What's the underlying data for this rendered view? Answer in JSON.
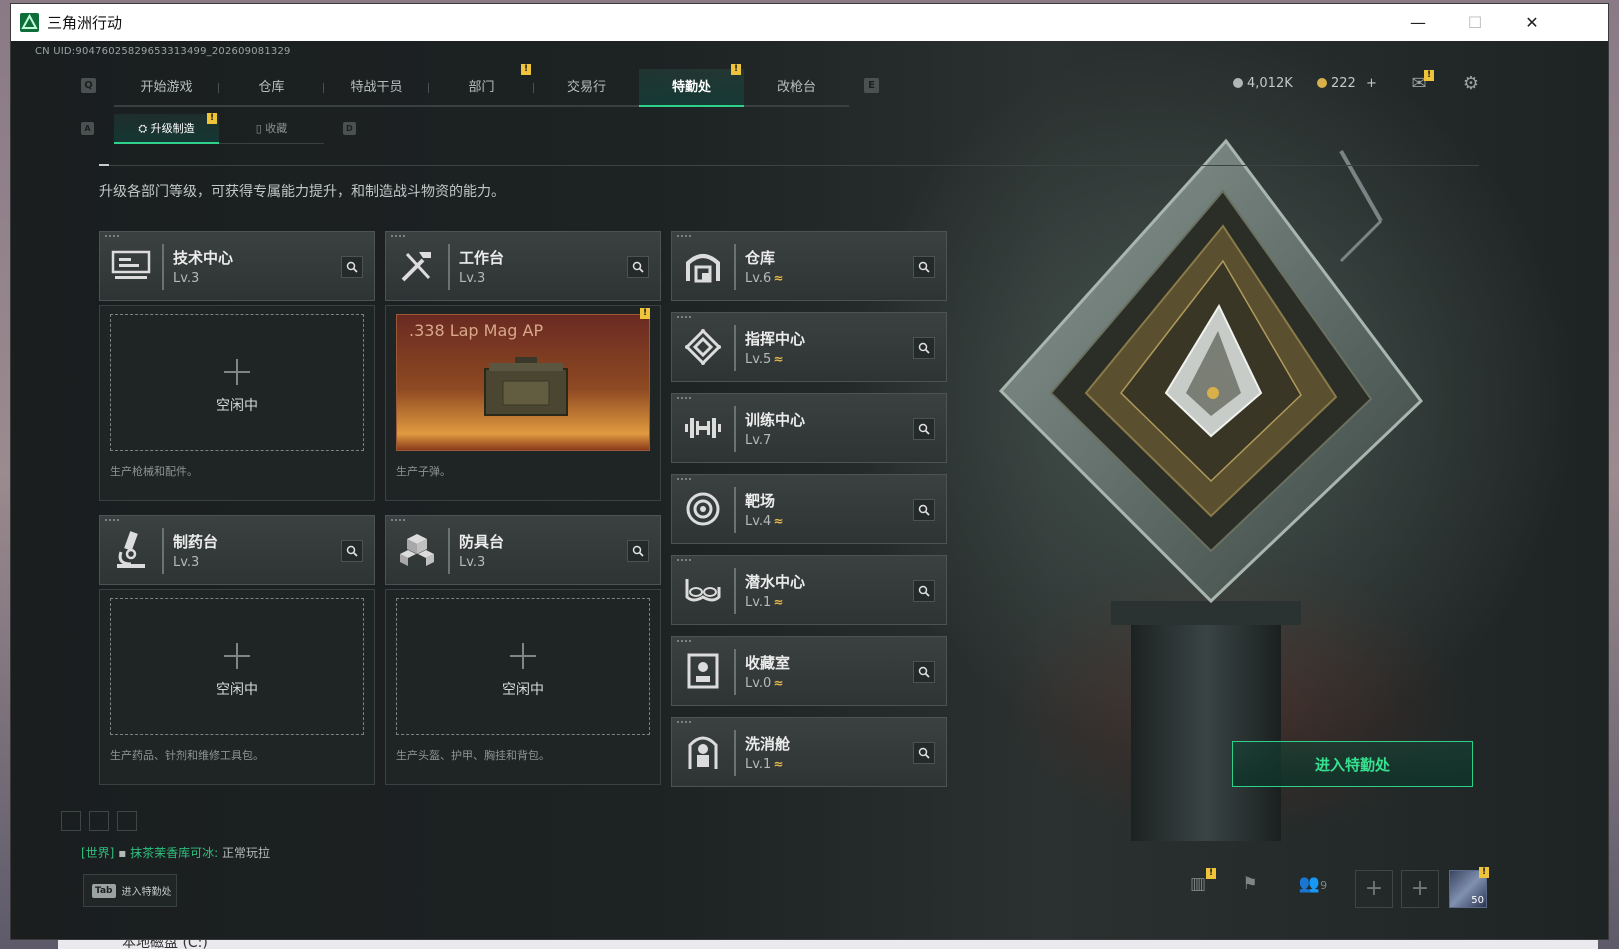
{
  "window": {
    "title": "三角洲行动",
    "minimize": "—",
    "maximize": "☐",
    "close": "✕"
  },
  "uid": "CN UID:904760258296533134​99_202609081329",
  "topnav": {
    "key_left": "Q",
    "key_right": "E",
    "tabs": [
      {
        "label": "开始游戏"
      },
      {
        "label": "仓库"
      },
      {
        "label": "特战干员"
      },
      {
        "label": "部门"
      },
      {
        "label": "交易行"
      },
      {
        "label": "特勤处"
      },
      {
        "label": "改枪台"
      }
    ],
    "active_tab": "特勤处",
    "notif_glyph": "!"
  },
  "currency": {
    "silver": "4,012K",
    "gold": "222",
    "gold_add": "+"
  },
  "subtabs": {
    "key_left": "A",
    "key_right": "D",
    "items": [
      {
        "label": "升级制造"
      },
      {
        "label": "收藏"
      }
    ]
  },
  "description": "升级各部门等级，可获得专属能力提升，和制造战斗物资的能力。",
  "production": [
    {
      "name": "技术中心",
      "level": "Lv.3",
      "slot_state": "空闲中",
      "slot_desc": "生产枪械和配件。"
    },
    {
      "name": "工作台",
      "level": "Lv.3",
      "product": ".338 Lap Mag AP",
      "slot_desc": "生产子弹。"
    },
    {
      "name": "制药台",
      "level": "Lv.3",
      "slot_state": "空闲中",
      "slot_desc": "生产药品、针剂和维修工具包。"
    },
    {
      "name": "防具台",
      "level": "Lv.3",
      "slot_state": "空闲中",
      "slot_desc": "生产头盔、护甲、胸挂和背包。"
    }
  ],
  "departments": [
    {
      "name": "仓库",
      "level": "Lv.6",
      "upgradable": true,
      "icon": "warehouse-icon"
    },
    {
      "name": "指挥中心",
      "level": "Lv.5",
      "upgradable": true,
      "icon": "command-center-icon"
    },
    {
      "name": "训练中心",
      "level": "Lv.7",
      "upgradable": false,
      "icon": "dumbbell-icon"
    },
    {
      "name": "靶场",
      "level": "Lv.4",
      "upgradable": true,
      "icon": "target-icon"
    },
    {
      "name": "潜水中心",
      "level": "Lv.1",
      "upgradable": true,
      "icon": "diving-mask-icon"
    },
    {
      "name": "收藏室",
      "level": "Lv.0",
      "upgradable": true,
      "icon": "collection-icon"
    },
    {
      "name": "洗消舱",
      "level": "Lv.1",
      "upgradable": true,
      "icon": "hazmat-icon"
    }
  ],
  "upgrade_glyph": "≈",
  "enter_button": "进入特勤处",
  "chat": {
    "channel": "[世界]",
    "user": "抹茶茉香库可冰:",
    "message": "正常玩拉"
  },
  "tab_hint": {
    "key": "Tab",
    "label": "进入特勤处"
  },
  "bottom": {
    "friends_count": "9",
    "avatar_level": "50"
  },
  "taskbar_peek": "本地磁盘 (C:)",
  "colors": {
    "accent": "#2fd08a",
    "notif": "#f0c43a",
    "upgrade": "#e6b84a"
  }
}
